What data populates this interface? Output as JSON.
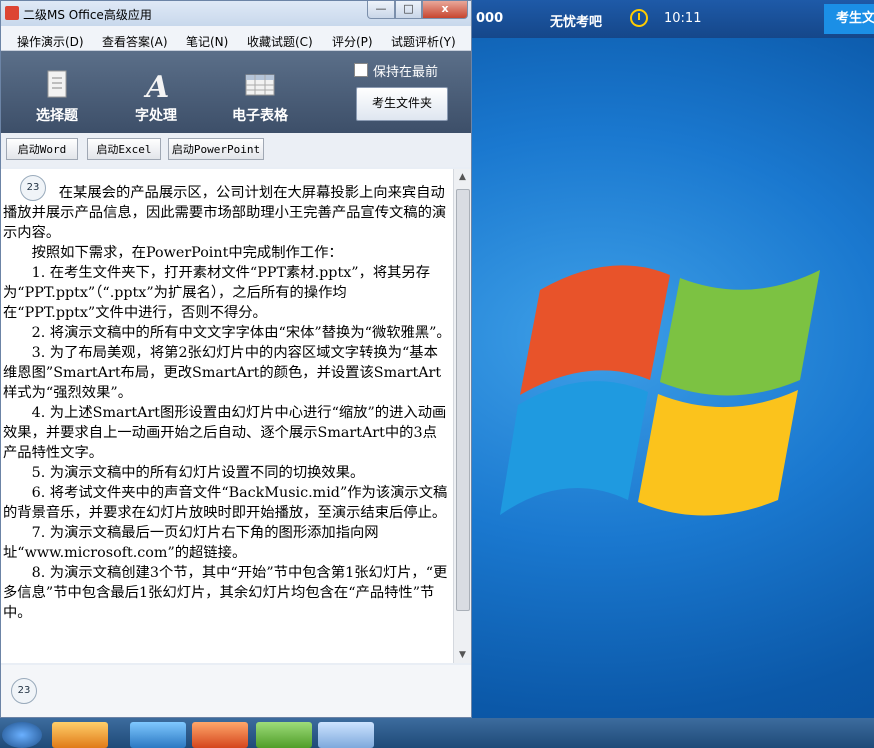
{
  "window": {
    "title": "二级MS Office高级应用",
    "min_glyph": "—",
    "max_glyph": "□",
    "close_glyph": "x"
  },
  "menu": [
    "操作演示(D)",
    "查看答案(A)",
    "笔记(N)",
    "收藏试题(C)",
    "评分(P)",
    "试题评析(Y)"
  ],
  "toolbar": {
    "select": "选择题",
    "word": "字处理",
    "excel": "电子表格",
    "topmost_label": "保持在最前",
    "folder_button": "考生文件夹"
  },
  "launch": {
    "word": "启动Word",
    "excel": "启动Excel",
    "ppt": "启动PowerPoint"
  },
  "question": {
    "number": "23",
    "paragraphs": [
      "在某展会的产品展示区，公司计划在大屏幕投影上向来宾自动播放并展示产品信息，因此需要市场部助理小王完善产品宣传文稿的演示内容。",
      "按照如下需求，在PowerPoint中完成制作工作：",
      "1. 在考生文件夹下，打开素材文件“PPT素材.pptx”，将其另存为“PPT.pptx”（“.pptx”为扩展名），之后所有的操作均在“PPT.pptx”文件中进行，否则不得分。",
      "2. 将演示文稿中的所有中文文字字体由“宋体”替换为“微软雅黑”。",
      "3. 为了布局美观，将第2张幻灯片中的内容区域文字转换为“基本维恩图”SmartArt布局，更改SmartArt的颜色，并设置该SmartArt样式为“强烈效果”。",
      "4. 为上述SmartArt图形设置由幻灯片中心进行“缩放”的进入动画效果，并要求自上一动画开始之后自动、逐个展示SmartArt中的3点产品特性文字。",
      "5. 为演示文稿中的所有幻灯片设置不同的切换效果。",
      "6. 将考试文件夹中的声音文件“BackMusic.mid”作为该演示文稿的背景音乐，并要求在幻灯片放映时即开始播放，至演示结束后停止。",
      "7. 为演示文稿最后一页幻灯片右下角的图形添加指向网址“www.microsoft.com”的超链接。",
      "8. 为演示文稿创建3个节，其中“开始”节中包含第1张幻灯片，“更多信息”节中包含最后1张幻灯片，其余幻灯片均包含在“产品特性”节中。"
    ],
    "bottom_number": "23"
  },
  "topbar": {
    "left_text": "000",
    "site": "无忧考吧",
    "time": "10:11",
    "button": "考生文"
  },
  "scroll_up": "▲",
  "scroll_down": "▼",
  "icons": [
    "app-icon",
    "select-icon",
    "word-icon",
    "excel-icon",
    "clock-icon",
    "start-icon",
    "windows-flag-icon"
  ]
}
